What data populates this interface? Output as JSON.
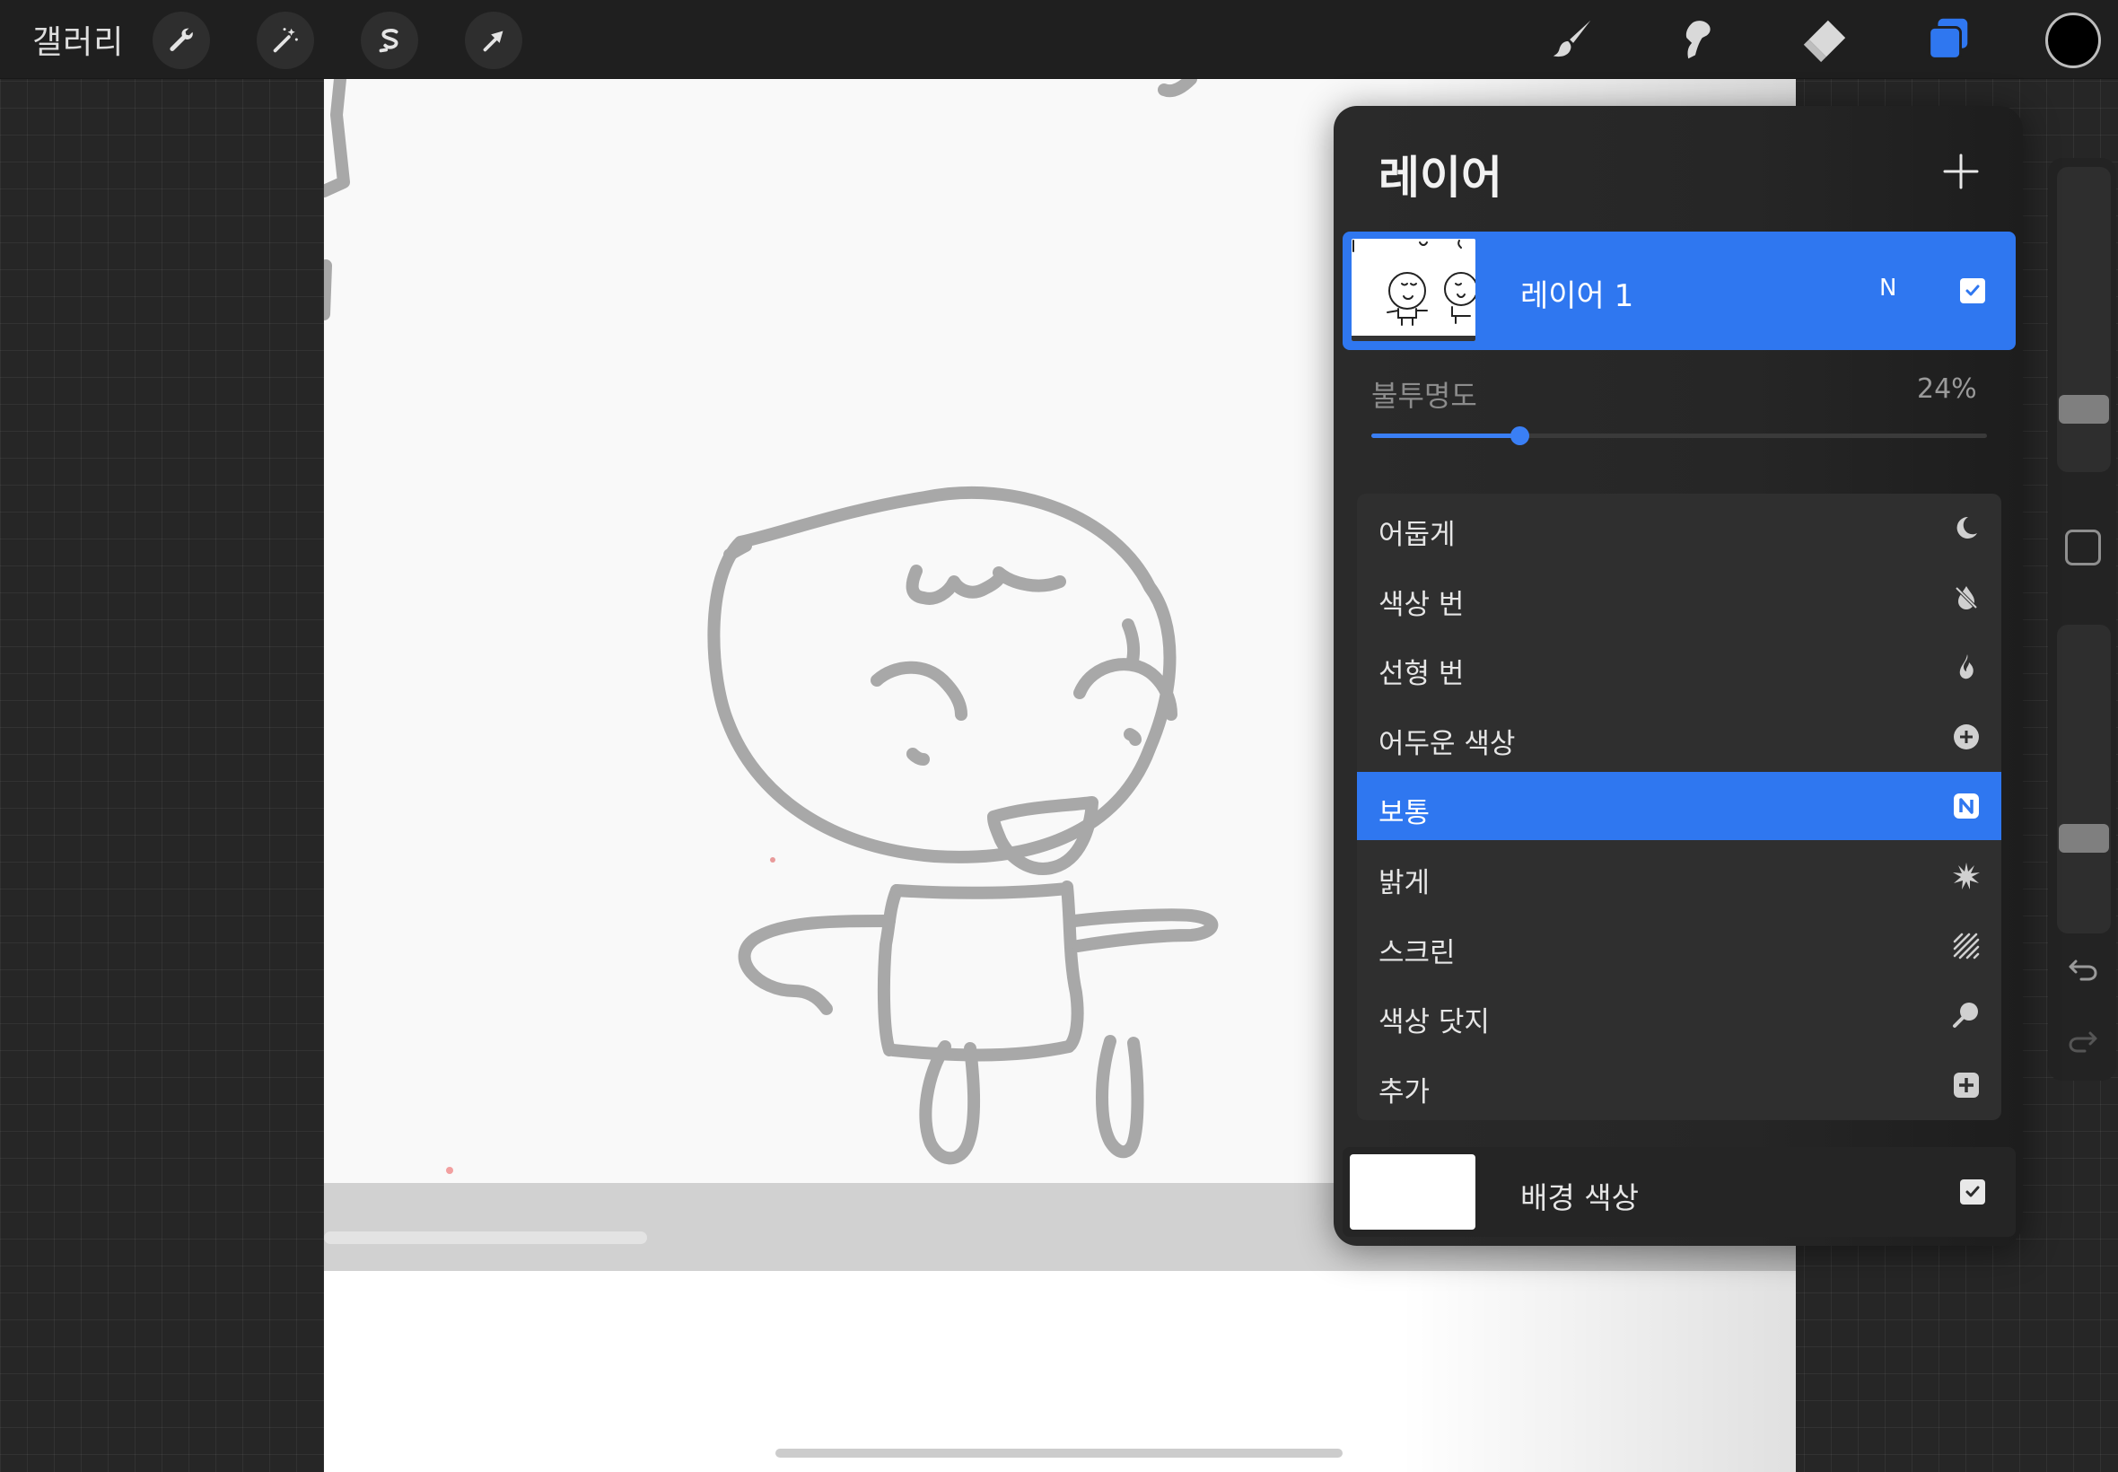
{
  "topbar": {
    "gallery_label": "갤러리",
    "left_tools": [
      "wrench-icon",
      "magic-wand-icon",
      "selection-icon",
      "transform-arrow-icon"
    ],
    "right_tools": [
      "brush-icon",
      "smudge-icon",
      "eraser-icon",
      "layers-icon"
    ],
    "active_tool": "layers-icon",
    "current_color": "#000000"
  },
  "sidebar": {
    "icons": [
      "modify-square-icon",
      "undo-icon",
      "redo-icon"
    ]
  },
  "layers_panel": {
    "title": "레이어",
    "add_icon": "plus-icon",
    "layer": {
      "name": "레이어 1",
      "blend_mode_abbr": "N",
      "visible": true
    },
    "opacity": {
      "label": "불투명도",
      "value_text": "24%",
      "value": 0.24
    },
    "blend_modes": [
      {
        "label": "어둡게",
        "icon": "moon-icon",
        "selected": false
      },
      {
        "label": "색상 번",
        "icon": "drop-slash-icon",
        "selected": false
      },
      {
        "label": "선형 번",
        "icon": "flame-icon",
        "selected": false
      },
      {
        "label": "어두운 색상",
        "icon": "plus-circle-icon",
        "selected": false
      },
      {
        "label": "보통",
        "icon": "n-badge-icon",
        "selected": true
      },
      {
        "label": "밝게",
        "icon": "starburst-icon",
        "selected": false
      },
      {
        "label": "스크린",
        "icon": "hatch-icon",
        "selected": false
      },
      {
        "label": "색상 닷지",
        "icon": "magnifier-icon",
        "selected": false
      },
      {
        "label": "추가",
        "icon": "plus-square-icon",
        "selected": false
      }
    ],
    "background": {
      "label": "배경 색상",
      "color": "#ffffff",
      "visible": true
    }
  },
  "colors": {
    "accent": "#2f77f0",
    "panel_bg": "#262626",
    "ink": "#9e9e9e"
  }
}
